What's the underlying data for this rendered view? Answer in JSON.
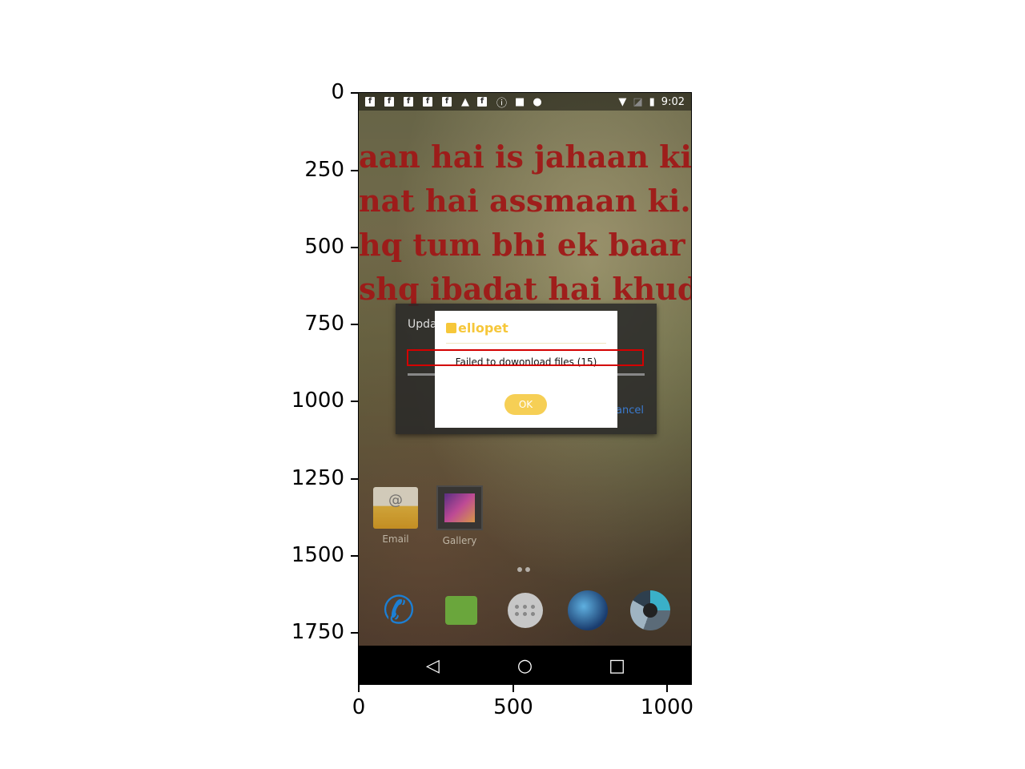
{
  "axes": {
    "y_ticks": [
      "0",
      "250",
      "500",
      "750",
      "1000",
      "1250",
      "1500",
      "1750"
    ],
    "x_ticks": [
      "0",
      "500",
      "1000"
    ]
  },
  "status_bar": {
    "time": "9:02",
    "left_icons": [
      "facebook-icon",
      "facebook-icon",
      "facebook-icon",
      "facebook-icon",
      "facebook-icon",
      "warning-icon",
      "facebook-icon",
      "info-icon",
      "lock-icon",
      "android-icon"
    ],
    "right_icons": [
      "wifi-icon",
      "no-sim-icon",
      "battery-charging-icon"
    ]
  },
  "wallpaper": {
    "lines": [
      "aan hai is jahaan ki..",
      "nat hai assmaan ki..",
      "hq tum bhi ek baar yar",
      "shq ibadat hai khuda k"
    ]
  },
  "background_dialog": {
    "title": "Upda",
    "cancel_label": "ancel"
  },
  "dialog": {
    "brand": "ellopet",
    "message": "Failed to dowonload files (15)",
    "ok_label": "OK"
  },
  "home": {
    "apps": [
      {
        "label": "Email",
        "icon": "email-icon"
      },
      {
        "label": "Gallery",
        "icon": "gallery-icon"
      }
    ],
    "dock": [
      "phone-icon",
      "messaging-icon",
      "app-drawer-icon",
      "browser-globe-icon",
      "camera-icon"
    ]
  },
  "navbar": {
    "back": "◁",
    "home": "○",
    "recents": "□"
  }
}
